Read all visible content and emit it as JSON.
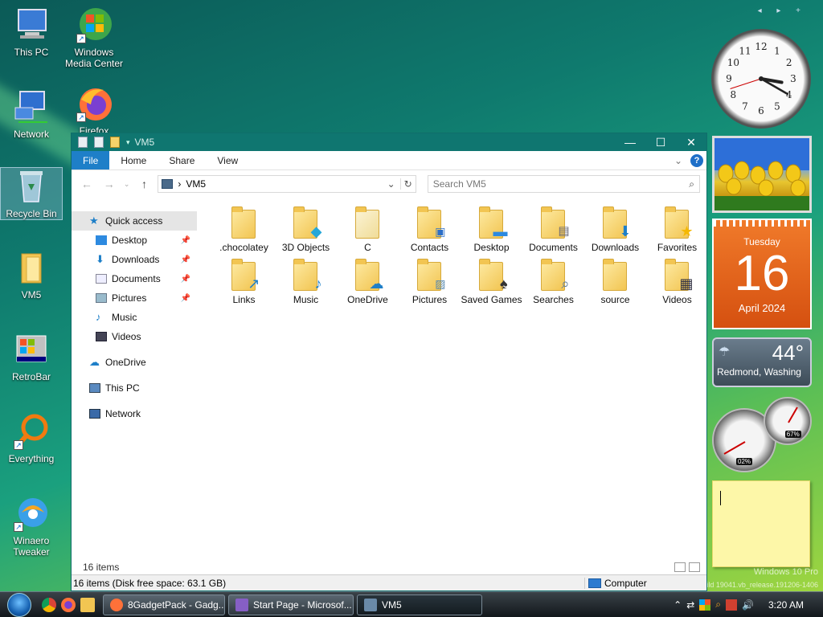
{
  "desktop": {
    "icons": [
      {
        "label": "This PC"
      },
      {
        "label": "Windows Media Center"
      },
      {
        "label": "Network"
      },
      {
        "label": "Firefox"
      },
      {
        "label": "Recycle Bin"
      },
      {
        "label": "VM5"
      },
      {
        "label": "RetroBar"
      },
      {
        "label": "Everything"
      },
      {
        "label": "Winaero Tweaker"
      }
    ]
  },
  "window": {
    "title": "VM5",
    "controls": {
      "minimize": "—",
      "maximize": "☐",
      "close": "✕"
    },
    "ribbon_tabs": [
      "File",
      "Home",
      "Share",
      "View"
    ],
    "help": "?",
    "address": {
      "path": "VM5",
      "separator": "›"
    },
    "search_placeholder": "Search VM5",
    "nav": {
      "quick_access": "Quick access",
      "pinned": [
        "Desktop",
        "Downloads",
        "Documents",
        "Pictures"
      ],
      "unpinned": [
        "Music",
        "Videos"
      ],
      "onedrive": "OneDrive",
      "this_pc": "This PC",
      "network": "Network"
    },
    "items": [
      ".chocolatey",
      "3D Objects",
      "C",
      "Contacts",
      "Desktop",
      "Documents",
      "Downloads",
      "Favorites",
      "Links",
      "Music",
      "OneDrive",
      "Pictures",
      "Saved Games",
      "Searches",
      "source",
      "Videos"
    ],
    "item_count": "16 items",
    "statusbar": {
      "left": "16 items (Disk free space: 63.1 GB)",
      "right": "Computer"
    }
  },
  "gadgets": {
    "clock": {
      "hour": 3,
      "minute": 20,
      "numerals": [
        "12",
        "1",
        "2",
        "3",
        "4",
        "5",
        "6",
        "7",
        "8",
        "9",
        "10",
        "11"
      ]
    },
    "calendar": {
      "weekday": "Tuesday",
      "day": "16",
      "month_year": "April 2024"
    },
    "weather": {
      "temp": "44°",
      "location": "Redmond, Washing"
    },
    "meters": {
      "cpu": "02%",
      "mem": "67%"
    }
  },
  "watermark": {
    "line1": "Windows 10 Pro",
    "line2": "Build 19041.vb_release.191206-1406"
  },
  "taskbar": {
    "buttons": [
      "8GadgetPack - Gadg...",
      "Start Page - Microsof...",
      "VM5"
    ],
    "time": "3:20 AM"
  },
  "colors": {
    "accent": "#1e7fc8",
    "titlebar": "#0f7670"
  }
}
